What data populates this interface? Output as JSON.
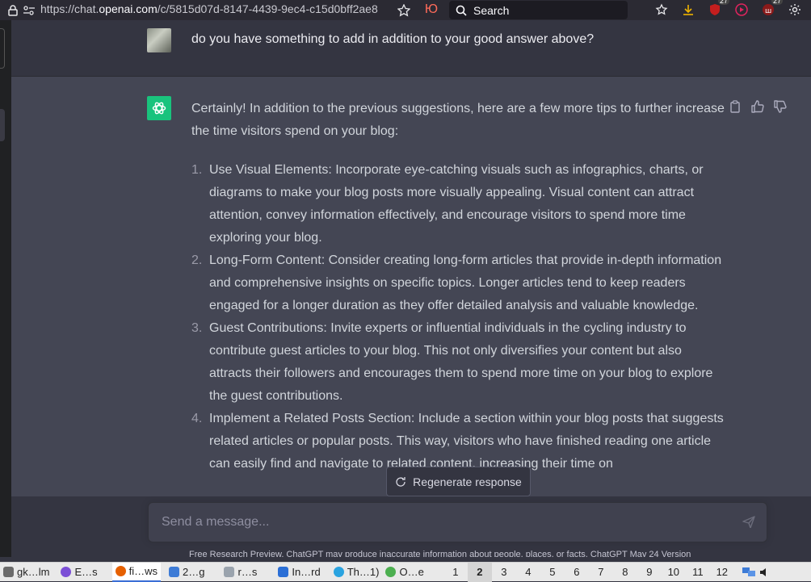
{
  "browser": {
    "url_prefix": "https://chat.",
    "url_domain": "openai.com",
    "url_path": "/c/5815d07d-8147-4439-9ec4-c15d0bff2ae8",
    "search_placeholder": "Search",
    "ext_badge_1": "27",
    "ext_badge_2": "27",
    "yu_label": "Ю"
  },
  "conversation": {
    "user_message": "do you have something to add in addition to your good answer above?",
    "assistant_intro": "Certainly! In addition to the previous suggestions, here are a few more tips to further increase the time visitors spend on your blog:",
    "items": [
      {
        "num": "1.",
        "text": "Use Visual Elements: Incorporate eye-catching visuals such as infographics, charts, or diagrams to make your blog posts more visually appealing. Visual content can attract attention, convey information effectively, and encourage visitors to spend more time exploring your blog."
      },
      {
        "num": "2.",
        "text": "Long-Form Content: Consider creating long-form articles that provide in-depth information and comprehensive insights on specific topics. Longer articles tend to keep readers engaged for a longer duration as they offer detailed analysis and valuable knowledge."
      },
      {
        "num": "3.",
        "text": "Guest Contributions: Invite experts or influential individuals in the cycling industry to contribute guest articles to your blog. This not only diversifies your content but also attracts their followers and encourages them to spend more time on your blog to explore the guest contributions."
      },
      {
        "num": "4.",
        "text": "Implement a Related Posts Section: Include a section within your blog posts that suggests related articles or popular posts. This way, visitors who have finished reading one article can easily find and navigate to related content, increasing their time on"
      }
    ],
    "regenerate_label": "Regenerate response",
    "input_placeholder": "Send a message...",
    "footer_note": "Free Research Preview. ChatGPT may produce inaccurate information about people, places, or facts. ChatGPT May 24 Version"
  },
  "taskbar": {
    "tasks": [
      {
        "label": "gk…lm",
        "color": "#6a6a6a"
      },
      {
        "label": "E…s",
        "color": "#7b4fd6"
      },
      {
        "label": "fi…ws",
        "color": "#e66000",
        "active": true
      },
      {
        "label": "2…g",
        "color": "#3d7bd6"
      },
      {
        "label": "r…s",
        "color": "#9aa3ad"
      },
      {
        "label": "In…rd",
        "color": "#2b6fd6"
      },
      {
        "label": "Th…1)",
        "color": "#2aa3e0"
      },
      {
        "label": "O…e",
        "color": "#4caf50"
      }
    ],
    "workspaces": [
      "1",
      "2",
      "3",
      "4",
      "5",
      "6",
      "7",
      "8",
      "9",
      "10",
      "11",
      "12"
    ],
    "active_workspace": "2"
  },
  "colors": {
    "gpt_green": "#19c37d",
    "bg": "#343541",
    "assistant_bg": "#444654"
  }
}
